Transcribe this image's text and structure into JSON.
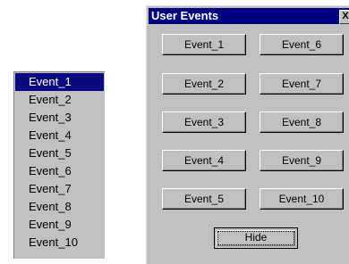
{
  "listbox": {
    "items": [
      "Event_1",
      "Event_2",
      "Event_3",
      "Event_4",
      "Event_5",
      "Event_6",
      "Event_7",
      "Event_8",
      "Event_9",
      "Event_10"
    ],
    "selected": "Event_1"
  },
  "dialog": {
    "title": "User Events",
    "close_glyph": "X",
    "buttons": [
      "Event_1",
      "Event_6",
      "Event_2",
      "Event_7",
      "Event_3",
      "Event_8",
      "Event_4",
      "Event_9",
      "Event_5",
      "Event_10"
    ],
    "hide_label": "Hide"
  },
  "colors": {
    "titlebar": "#000080",
    "selection": "#0a0a80",
    "face": "#c0c0c0"
  }
}
